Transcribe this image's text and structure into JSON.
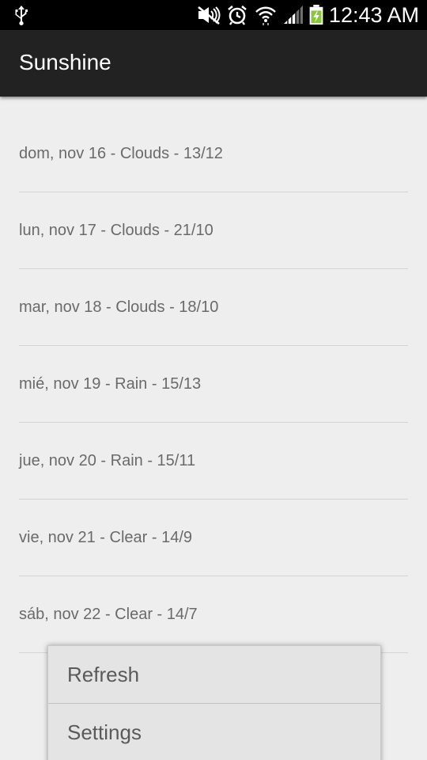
{
  "status_bar": {
    "time": "12:43 AM",
    "icons": [
      "usb-icon",
      "mute-icon",
      "alarm-icon",
      "wifi-icon",
      "signal-icon",
      "battery-charging-icon"
    ]
  },
  "action_bar": {
    "title": "Sunshine"
  },
  "forecast": {
    "items": [
      {
        "label": "dom, nov 16 - Clouds - 13/12"
      },
      {
        "label": "lun, nov 17 - Clouds - 21/10"
      },
      {
        "label": "mar, nov 18 - Clouds - 18/10"
      },
      {
        "label": "mié, nov 19 - Rain - 15/13"
      },
      {
        "label": "jue, nov 20 - Rain - 15/11"
      },
      {
        "label": "vie, nov 21 - Clear - 14/9"
      },
      {
        "label": "sáb, nov 22 - Clear - 14/7"
      }
    ]
  },
  "menu": {
    "items": [
      {
        "label": "Refresh"
      },
      {
        "label": "Settings"
      }
    ]
  },
  "colors": {
    "status_bar": "#000000",
    "action_bar": "#222222",
    "background": "#eeeeee",
    "list_text": "#6a6a6a",
    "menu_background": "#e4e4e4",
    "battery_charge": "#8bc53f"
  }
}
